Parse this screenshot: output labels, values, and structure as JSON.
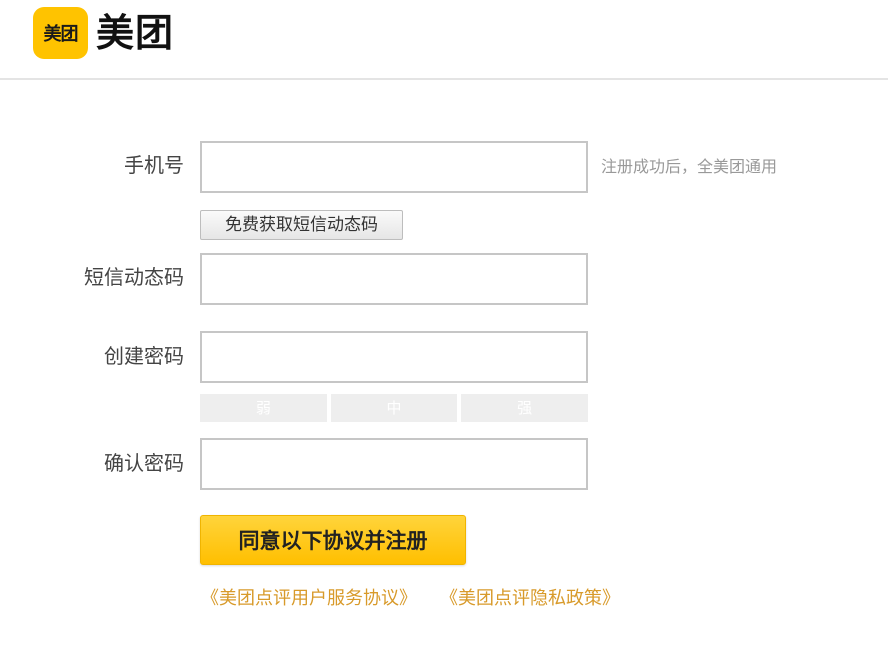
{
  "header": {
    "logo_badge": "美团",
    "logo_text": "美团"
  },
  "form": {
    "phone": {
      "label": "手机号",
      "value": "",
      "hint": "注册成功后，全美团通用"
    },
    "sms_button_label": "免费获取短信动态码",
    "sms_code": {
      "label": "短信动态码",
      "value": ""
    },
    "password": {
      "label": "创建密码",
      "value": ""
    },
    "strength": [
      "弱",
      "中",
      "强"
    ],
    "confirm_password": {
      "label": "确认密码",
      "value": ""
    },
    "submit_label": "同意以下协议并注册",
    "agreements": [
      "《美团点评用户服务协议》",
      "《美团点评隐私政策》"
    ]
  },
  "colors": {
    "brand_yellow": "#ffc300",
    "link_orange": "#d89a2a",
    "hint_gray": "#999999"
  }
}
